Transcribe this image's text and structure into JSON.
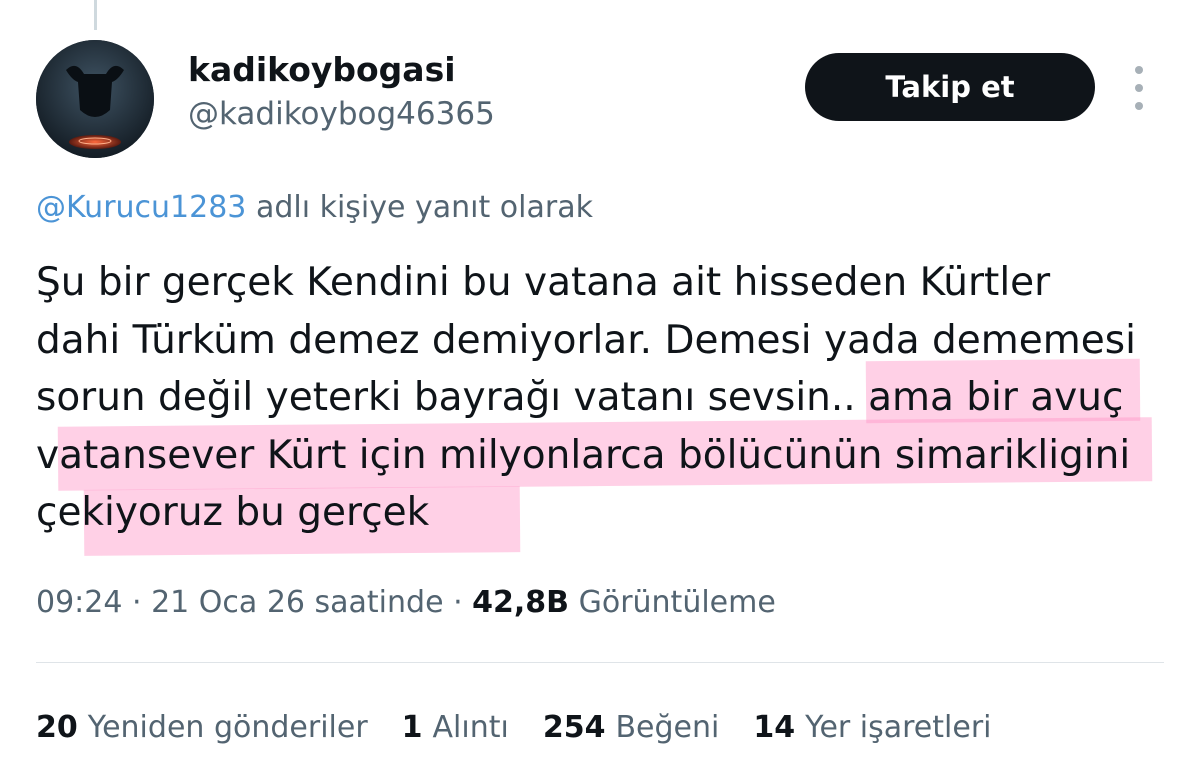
{
  "author": {
    "display_name": "kadikoybogasi",
    "handle": "@kadikoybog46365"
  },
  "follow_label": "Takip et",
  "reply_context": {
    "mention": "@Kurucu1283",
    "suffix": " adlı kişiye yanıt olarak"
  },
  "tweet": {
    "lines": [
      "Şu bir gerçek Kendini bu vatana ait hisseden Kürtler",
      "dahi Türküm demez demiyorlar. Demesi yada dememesi",
      "sorun değil yeterki bayrağı vatanı sevsin.. ama bir avuç",
      "vatansever Kürt için milyonlarca bölücünün simarikligini",
      "çekiyoruz bu gerçek"
    ]
  },
  "meta": {
    "time": "09:24",
    "separator1": " · ",
    "date": "21 Oca 26 saatinde",
    "separator2": " · ",
    "views_count": "42,8B",
    "views_label": "Görüntüleme"
  },
  "stats": {
    "retweets": {
      "count": "20",
      "label": "Yeniden gönderiler"
    },
    "quotes": {
      "count": "1",
      "label": "Alıntı"
    },
    "likes": {
      "count": "254",
      "label": "Beğeni"
    },
    "bookmarks": {
      "count": "14",
      "label": "Yer işaretleri"
    }
  },
  "colors": {
    "highlight": "#ff96c8",
    "link": "#4b94d6",
    "button_bg": "#0f1419",
    "secondary_text": "#536471"
  }
}
